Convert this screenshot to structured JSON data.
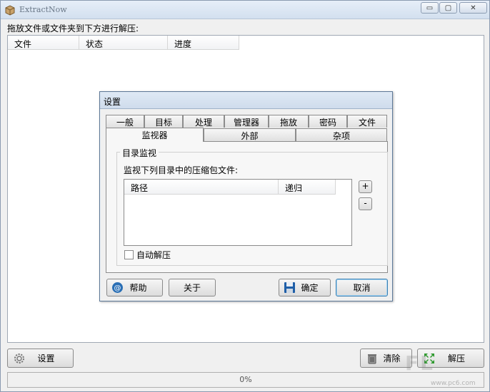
{
  "app": {
    "title": "ExtractNow"
  },
  "window_controls": {
    "minimize": "▭",
    "maximize": "▢",
    "close": "✕"
  },
  "main": {
    "instruction": "拖放文件或文件夹到下方进行解压:",
    "columns": [
      "文件",
      "状态",
      "进度"
    ],
    "buttons": {
      "settings": "设置",
      "clear": "清除",
      "extract": "解压"
    },
    "progress": {
      "value": 0,
      "text": "0%"
    }
  },
  "watermark": {
    "text": "FL",
    "sub": "www.pc6.com"
  },
  "settings_dialog": {
    "title": "设置",
    "tabs_row1": [
      "一般",
      "目标",
      "处理",
      "管理器",
      "拖放",
      "密码",
      "文件"
    ],
    "tabs_row2": [
      "监视器",
      "外部",
      "杂项"
    ],
    "active_tab": "监视器",
    "group_title": "目录监视",
    "monitor_label": "监视下列目录中的压缩包文件:",
    "dir_columns": [
      "路径",
      "递归"
    ],
    "add_button": "+",
    "remove_button": "-",
    "auto_extract_label": "自动解压",
    "auto_extract_checked": false,
    "buttons": {
      "help": "帮助",
      "about": "关于",
      "ok": "确定",
      "cancel": "取消"
    }
  },
  "colors": {
    "accent": "#3c7fb1",
    "titlebar": "#d3e0ef",
    "dialog_border": "#5d7897"
  }
}
